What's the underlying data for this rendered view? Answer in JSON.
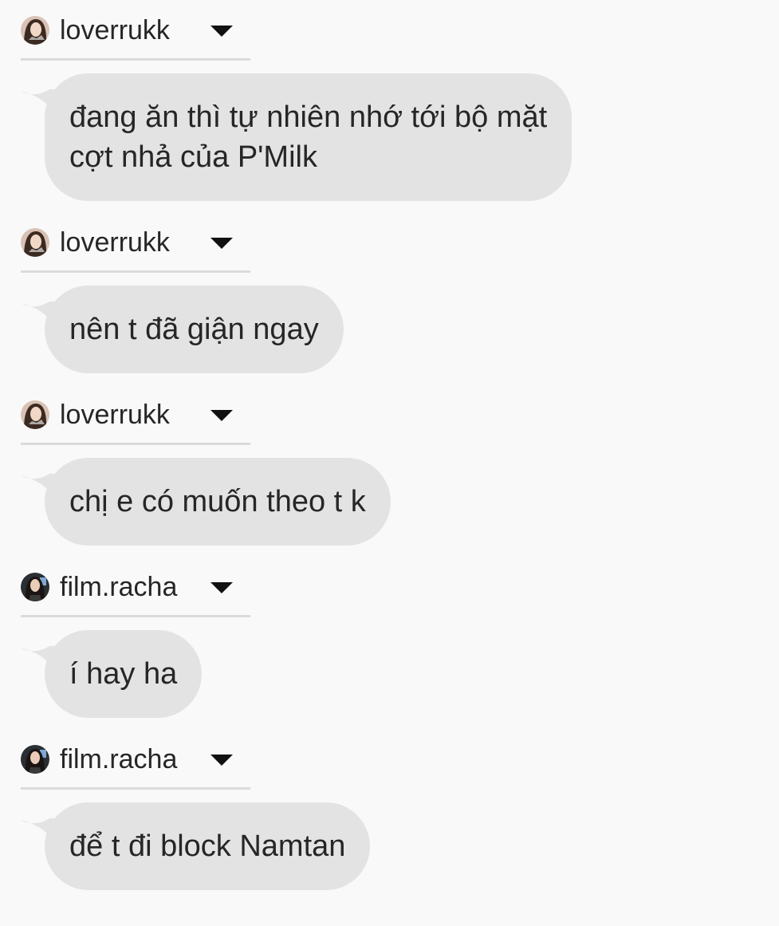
{
  "messages": [
    {
      "username": "loverrukk",
      "avatar_icon": "profile-photo-loverrukk",
      "lines": [
        "đang ăn thì tự nhiên nhớ tới bộ mặt",
        "cợt nhả của P'Milk"
      ]
    },
    {
      "username": "loverrukk",
      "avatar_icon": "profile-photo-loverrukk",
      "lines": [
        "nên t đã giận ngay"
      ]
    },
    {
      "username": "loverrukk",
      "avatar_icon": "profile-photo-loverrukk",
      "lines": [
        "chị e có muốn theo t k"
      ]
    },
    {
      "username": "film.racha",
      "avatar_icon": "profile-photo-film-racha",
      "lines": [
        "í hay ha"
      ]
    },
    {
      "username": "film.racha",
      "avatar_icon": "profile-photo-film-racha",
      "lines": [
        "để t đi block Namtan"
      ]
    }
  ],
  "colors": {
    "background": "#f9f9f9",
    "bubble": "#e3e3e3",
    "text": "#262626",
    "divider": "#dbdbdb"
  }
}
